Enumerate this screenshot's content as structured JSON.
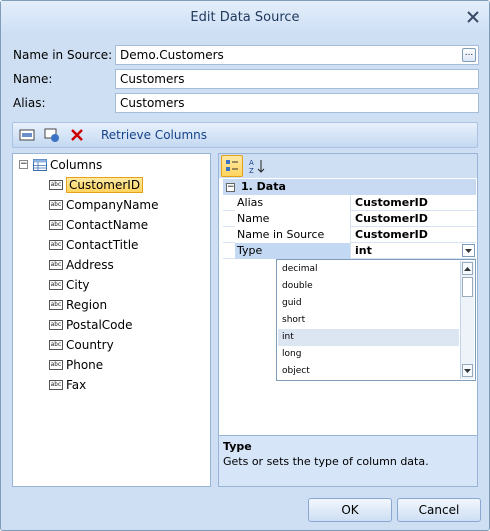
{
  "window": {
    "title": "Edit Data Source"
  },
  "fields": {
    "name_in_source_label": "Name in Source:",
    "name_in_source_value": "Demo.Customers",
    "name_label": "Name:",
    "name_value": "Customers",
    "alias_label": "Alias:",
    "alias_value": "Customers",
    "ellipsis": "..."
  },
  "toolbar": {
    "retrieve_label": "Retrieve Columns"
  },
  "tree": {
    "root": "Columns",
    "items": [
      "CustomerID",
      "CompanyName",
      "ContactName",
      "ContactTitle",
      "Address",
      "City",
      "Region",
      "PostalCode",
      "Country",
      "Phone",
      "Fax"
    ],
    "selected": "CustomerID"
  },
  "propgrid": {
    "category": "1. Data",
    "rows": [
      {
        "name": "Alias",
        "value": "CustomerID"
      },
      {
        "name": "Name",
        "value": "CustomerID"
      },
      {
        "name": "Name in Source",
        "value": "CustomerID"
      },
      {
        "name": "Type",
        "value": "int"
      }
    ],
    "dropdown_options": [
      "decimal",
      "double",
      "guid",
      "short",
      "int",
      "long",
      "object"
    ],
    "dropdown_selected": "int",
    "desc_title": "Type",
    "desc_text": "Gets or sets the type of column data."
  },
  "buttons": {
    "ok": "OK",
    "cancel": "Cancel"
  },
  "colors": {
    "selection": "#ffd45f",
    "accent": "#15428b",
    "delete": "#cc0000"
  }
}
